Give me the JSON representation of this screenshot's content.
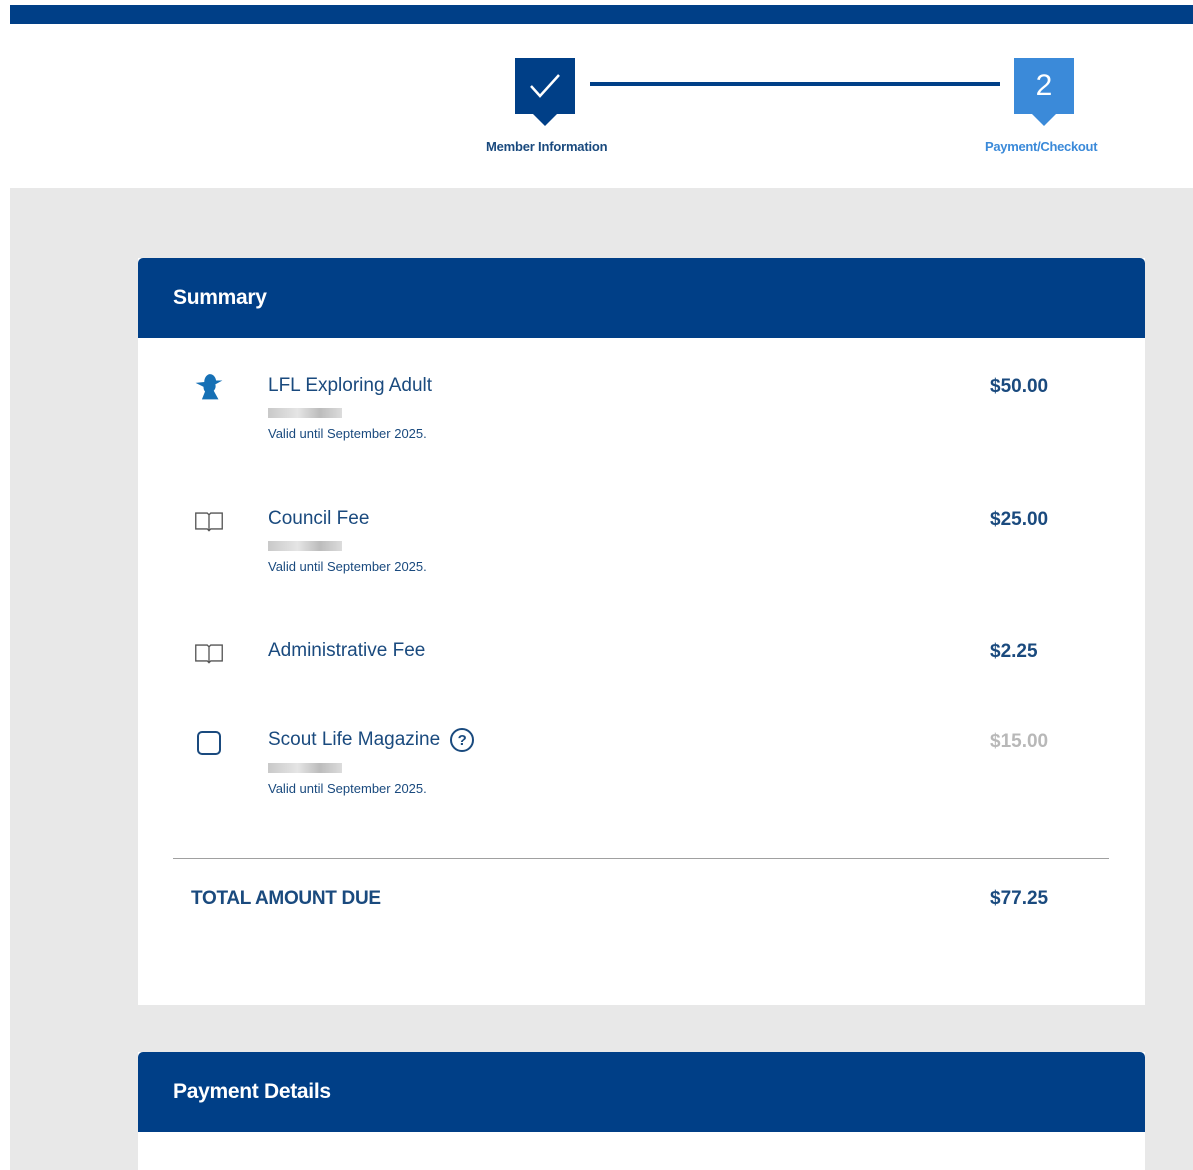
{
  "colors": {
    "primary": "#003f87",
    "active_step": "#3b8ad9",
    "text": "#1a4a7e",
    "muted_price": "#b8b8b8",
    "background": "#e8e8e8"
  },
  "stepper": {
    "steps": [
      {
        "label": "Member Information",
        "status": "complete",
        "icon": "check-icon"
      },
      {
        "label": "Payment/Checkout",
        "status": "active",
        "number": "2"
      }
    ]
  },
  "summary": {
    "title": "Summary",
    "items": [
      {
        "icon": "scout-silhouette-icon",
        "title": "LFL Exploring Adult",
        "valid": "Valid until September 2025.",
        "price": "$50.00"
      },
      {
        "icon": "book-icon",
        "title": "Council Fee",
        "valid": "Valid until September 2025.",
        "price": "$25.00"
      },
      {
        "icon": "book-icon",
        "title": "Administrative Fee",
        "price": "$2.25"
      },
      {
        "icon": "checkbox",
        "title": "Scout Life Magazine",
        "help_icon": "question-circle-icon",
        "help_glyph": "?",
        "valid": "Valid until September 2025.",
        "price": "$15.00",
        "checked": false
      }
    ],
    "total_label": "TOTAL AMOUNT DUE",
    "total_value": "$77.25"
  },
  "payment": {
    "title": "Payment Details"
  }
}
